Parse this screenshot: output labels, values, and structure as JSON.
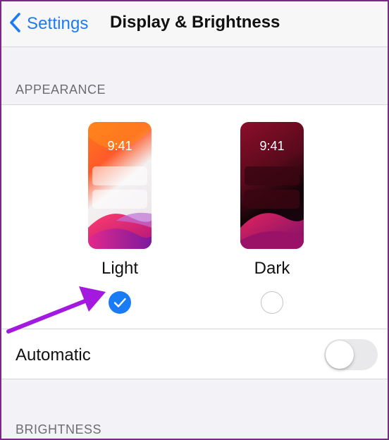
{
  "navbar": {
    "back_label": "Settings",
    "title": "Display & Brightness"
  },
  "appearance": {
    "header": "APPEARANCE",
    "options": [
      {
        "label": "Light",
        "time": "9:41",
        "selected": true
      },
      {
        "label": "Dark",
        "time": "9:41",
        "selected": false
      }
    ]
  },
  "automatic": {
    "label": "Automatic",
    "enabled": false
  },
  "brightness": {
    "header": "BRIGHTNESS"
  },
  "colors": {
    "accent": "#1a7cf5",
    "annotation_arrow": "#a319e0",
    "toggle_off": "#e9e9eb"
  },
  "icons": {
    "back": "chevron-left-icon",
    "selected": "checkmark-icon"
  }
}
